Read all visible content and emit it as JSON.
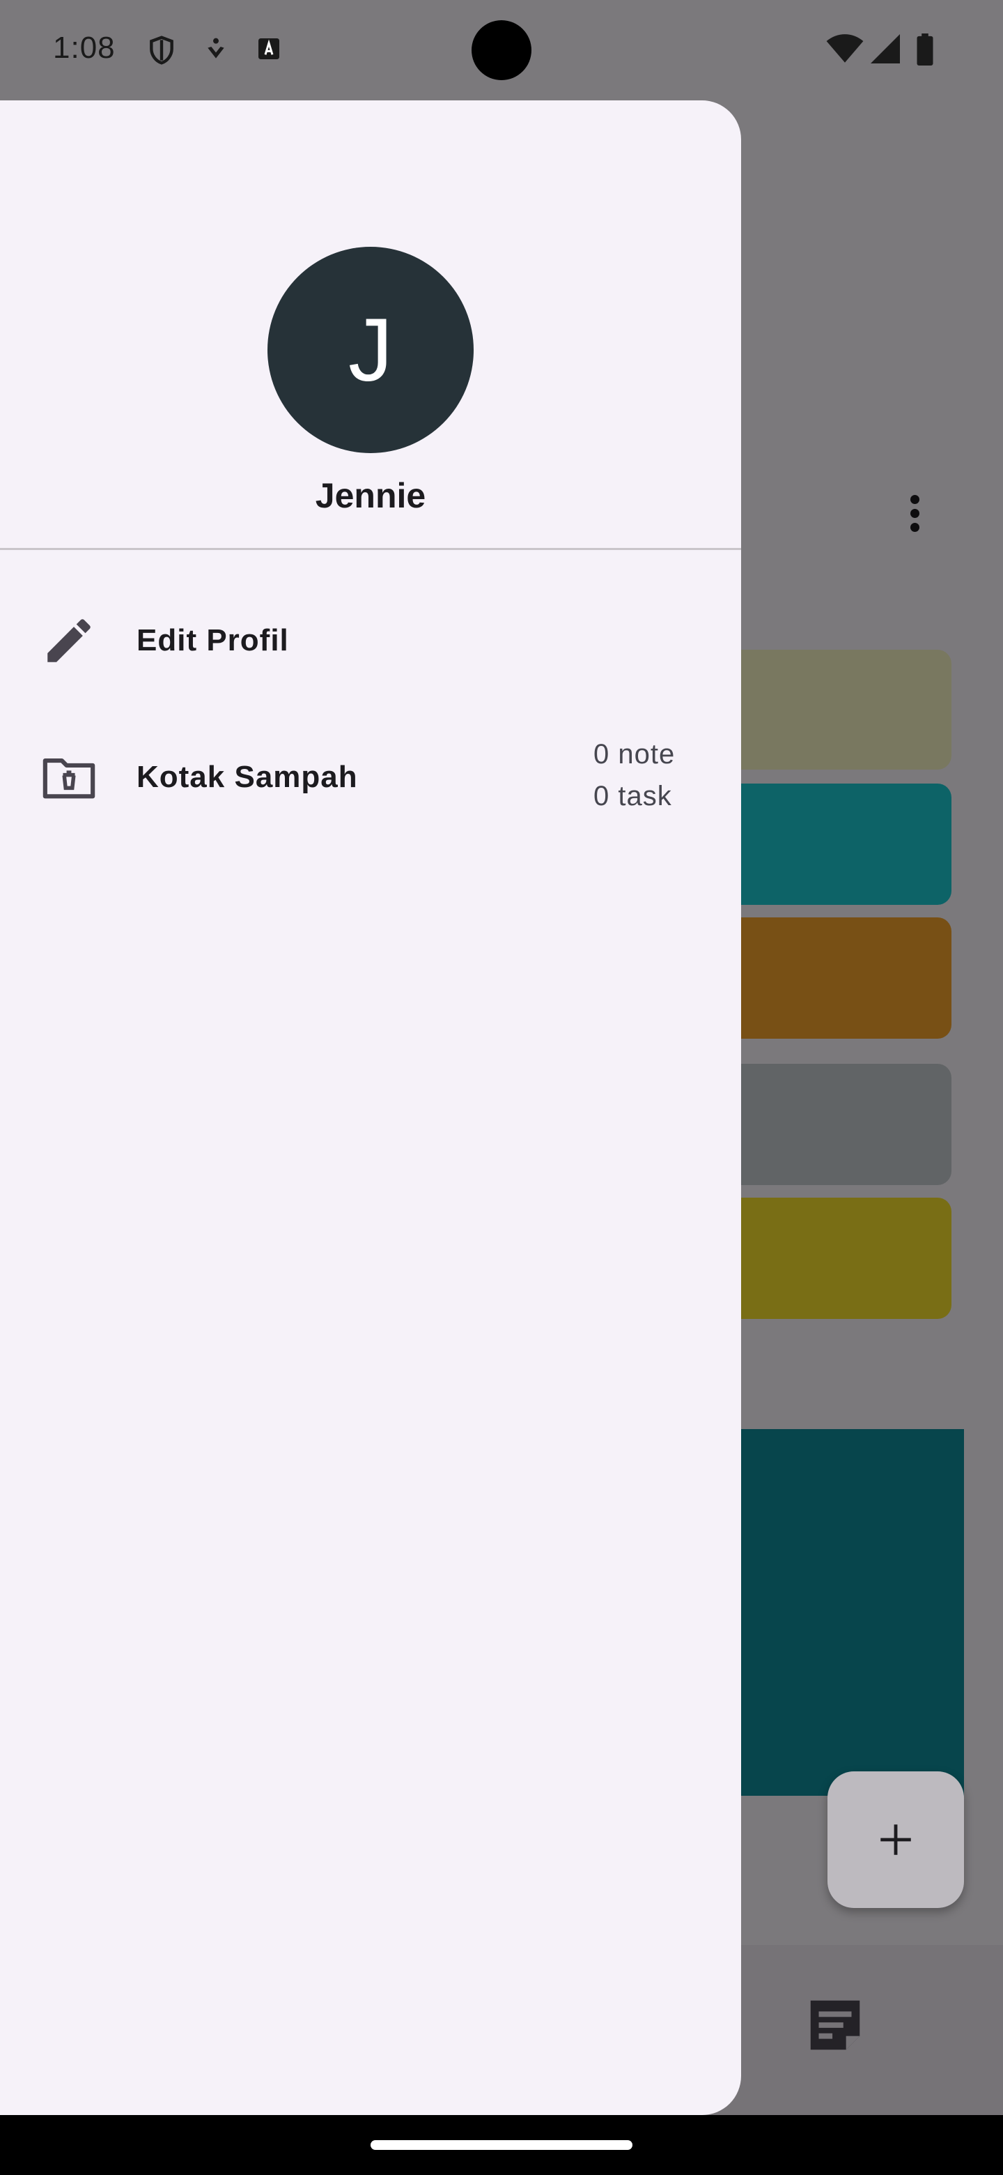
{
  "status_bar": {
    "time": "1:08",
    "icons": [
      "shield-icon",
      "accessibility-icon",
      "keyboard-a-icon",
      "wifi-icon",
      "cell-signal-icon",
      "battery-icon"
    ]
  },
  "background_app": {
    "card_colors": [
      "#f3f0c0",
      "#1ac7cf",
      "#f0a12a",
      "#c2c9cc",
      "#f2dd2a"
    ],
    "featured_color": "#0e8a99",
    "fab_icon": "plus-icon",
    "bottom_icon": "notes-icon",
    "more_icon": "more-vert-icon"
  },
  "drawer": {
    "avatar_initial": "J",
    "user_name": "Jennie",
    "items": [
      {
        "label": "Edit Profil",
        "icon": "edit-icon"
      },
      {
        "label": "Kotak Sampah",
        "icon": "folder-trash-icon",
        "meta_line1": "0 note",
        "meta_line2": "0 task"
      }
    ]
  },
  "colors": {
    "drawer_bg": "#f6f2f9",
    "avatar_bg": "#263238",
    "text_primary": "#1c1b1f"
  }
}
